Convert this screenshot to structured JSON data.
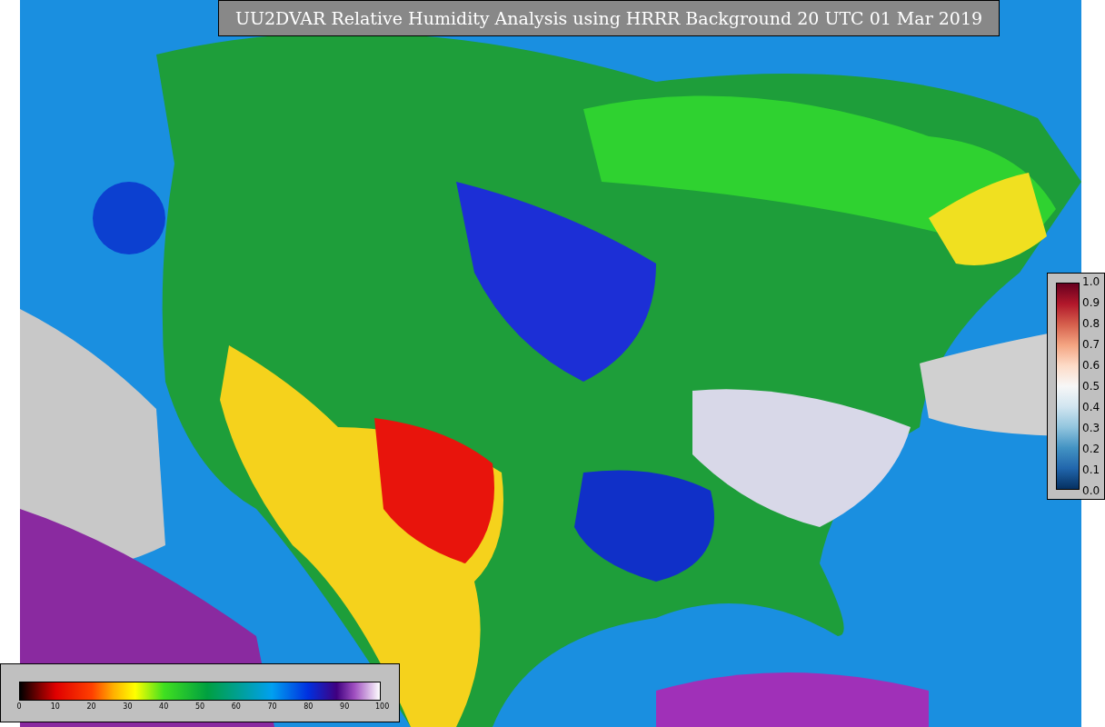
{
  "title": "UU2DVAR Relative Humidity Analysis using HRRR Background 20 UTC 01 Mar 2019",
  "ratio_colorbar": {
    "ticks": [
      "1.0",
      "0.9",
      "0.8",
      "0.7",
      "0.6",
      "0.5",
      "0.4",
      "0.3",
      "0.2",
      "0.1",
      "0.0"
    ]
  },
  "humidity_colorbar": {
    "ticks": [
      "0",
      "10",
      "20",
      "30",
      "40",
      "50",
      "60",
      "70",
      "80",
      "90",
      "100"
    ]
  }
}
